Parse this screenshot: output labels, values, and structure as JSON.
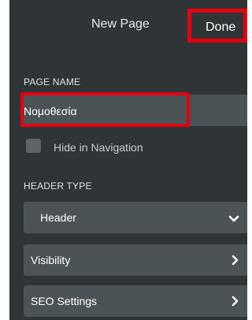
{
  "header": {
    "title": "New Page",
    "done_label": "Done"
  },
  "page_name": {
    "label": "PAGE NAME",
    "value": "Νομοθεσία"
  },
  "hide_in_navigation": {
    "label": "Hide in Navigation",
    "checked": false
  },
  "header_type": {
    "label": "HEADER TYPE",
    "selected": "Header",
    "icon": "chevron-down-icon"
  },
  "visibility": {
    "label": "Visibility",
    "icon": "chevron-right-icon"
  },
  "seo_settings": {
    "label": "SEO Settings",
    "icon": "chevron-right-icon"
  },
  "colors": {
    "panel_bg": "#2f3436",
    "control_bg": "#4c5356",
    "highlight": "#e4000f"
  }
}
